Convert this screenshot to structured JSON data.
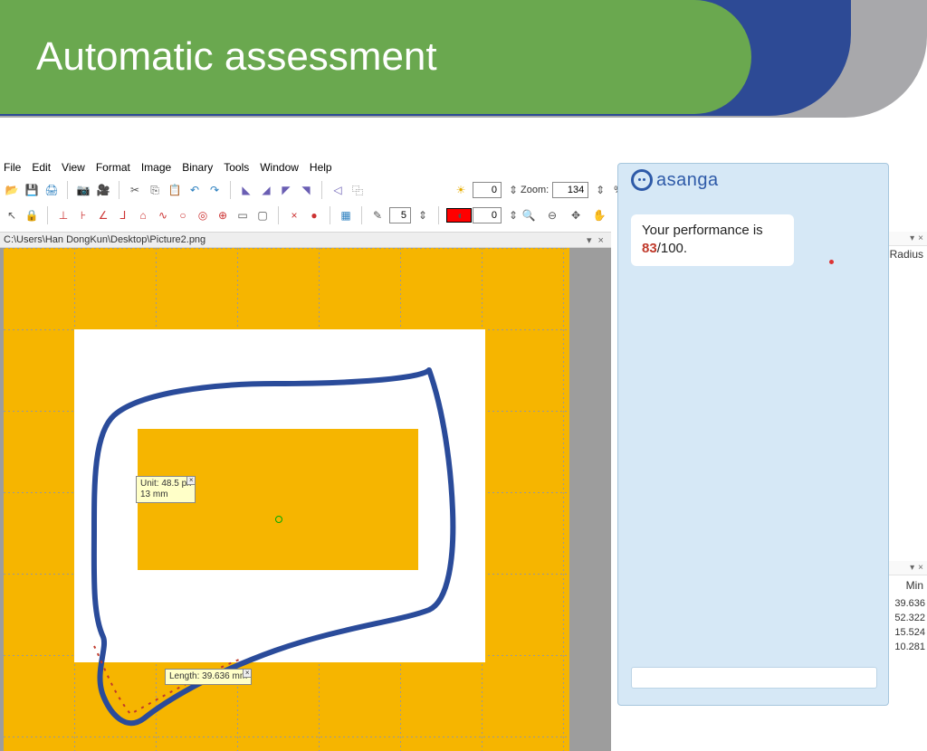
{
  "slide": {
    "title": "Automatic assessment"
  },
  "menu": {
    "file": "File",
    "edit": "Edit",
    "view": "View",
    "format": "Format",
    "image": "Image",
    "binary": "Binary",
    "tools": "Tools",
    "window": "Window",
    "help": "Help"
  },
  "toolbar": {
    "spinner1": "0",
    "zoom_label": "Zoom:",
    "zoom_value": "134",
    "zoom_pct": "%",
    "spinner2": "0",
    "num5": "5"
  },
  "path": {
    "value": "C:\\Users\\Han DongKun\\Desktop\\Picture2.png",
    "right": "▾ ×"
  },
  "tips": {
    "unit_line1": "Unit:  48.5 px",
    "unit_line2": "13 mm",
    "length": "Length: 39.636 mm"
  },
  "chat": {
    "brand": "asanga",
    "msg_prefix": "Your performance is ",
    "score": "83",
    "msg_suffix": "/100."
  },
  "props": {
    "radius_label": "Radius",
    "min_label": "Min",
    "vals": [
      "39.636",
      "52.322",
      "15.524",
      "10.281"
    ]
  }
}
